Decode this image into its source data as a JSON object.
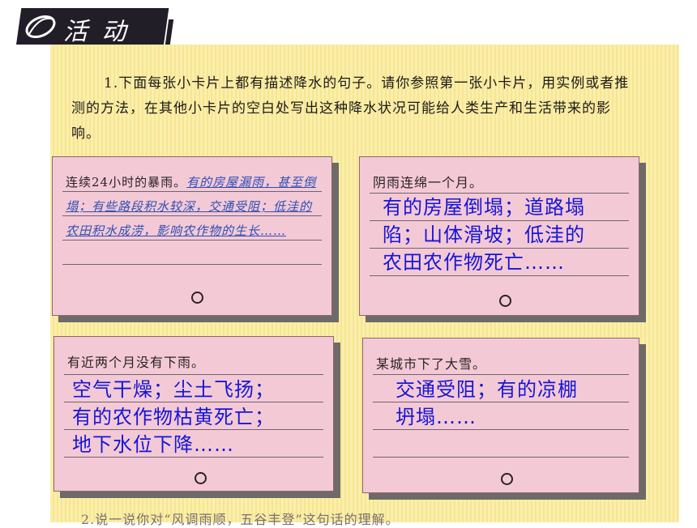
{
  "header": {
    "title": "活 动"
  },
  "intro": "1.下面每张小卡片上都有描述降水的句子。请你参照第一张小卡片，用实例或者推测的方法，在其他小卡片的空白处写出这种降水状况可能给人类生产和生活带来的影响。",
  "cards": [
    {
      "prompt": "连续24小时的暴雨。",
      "example": "有的房屋漏雨，甚至倒塌；有些路段积水较深，交通受阻；低洼的农田积水成涝，影响农作物的生长……"
    },
    {
      "prompt": "阴雨连绵一个月。",
      "answer": [
        "有的房屋倒塌；道路塌",
        "陷；山体滑坡；低洼的",
        "农田农作物死亡……"
      ]
    },
    {
      "prompt": "有近两个月没有下雨。",
      "answer": [
        "空气干燥；尘土飞扬；",
        "有的农作物枯黄死亡；",
        "地下水位下降……"
      ]
    },
    {
      "prompt": "某城市下了大雪。",
      "answer": [
        "交通受阻；有的凉棚",
        "坍塌……"
      ]
    }
  ],
  "footer_partial": "2.说一说你对“风调雨顺，五谷丰登”这句话的理解。"
}
